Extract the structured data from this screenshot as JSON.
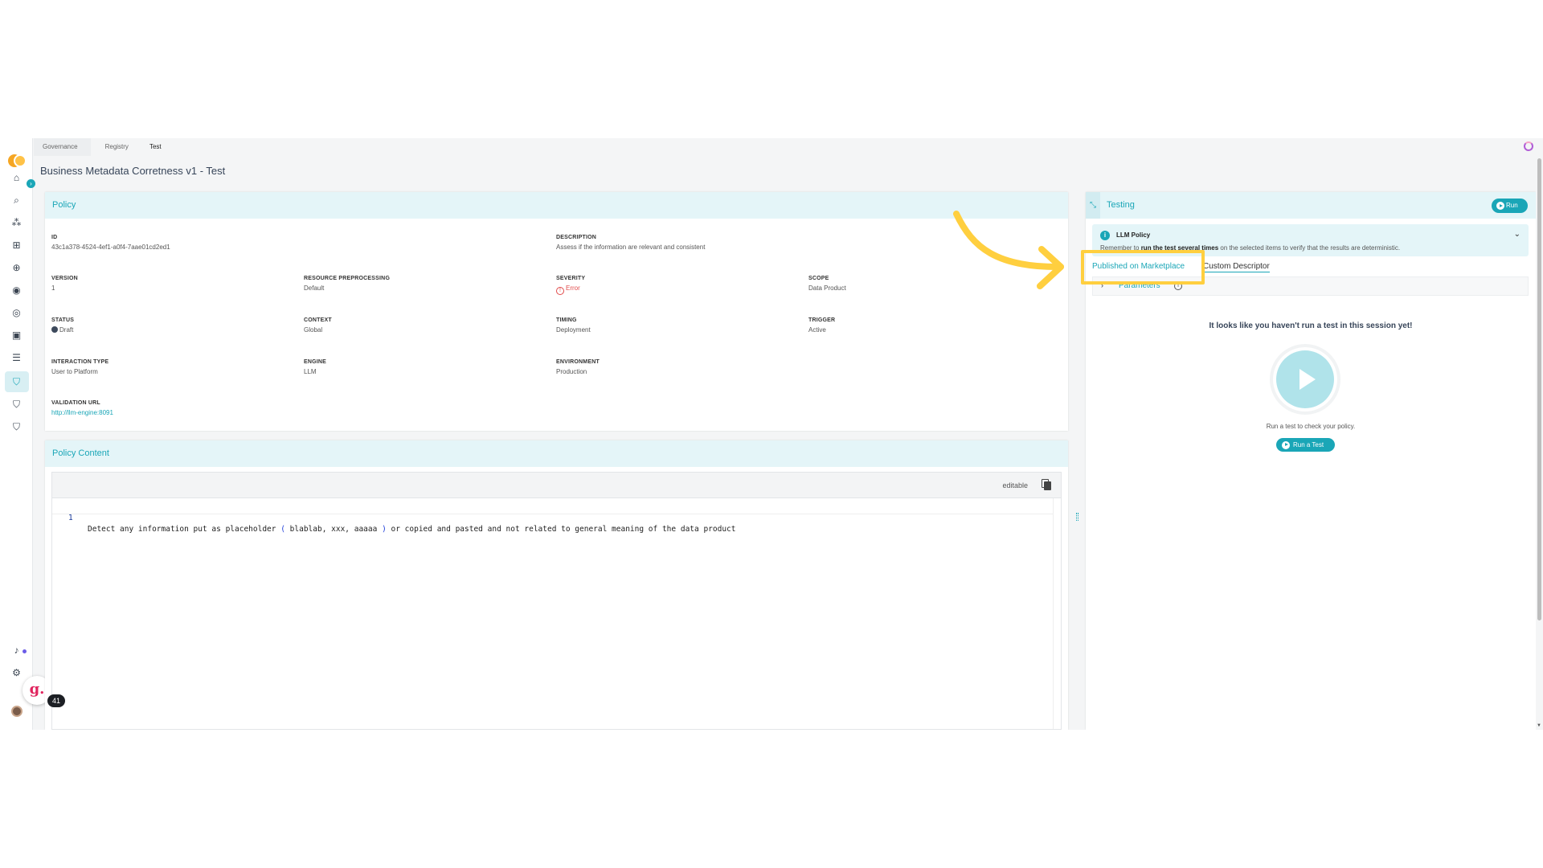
{
  "breadcrumb": [
    "Governance",
    "Registry",
    "Test"
  ],
  "page_title": "Business Metadata Corretness v1 - Test",
  "policy": {
    "header": "Policy",
    "fields": {
      "id": {
        "label": "ID",
        "value": "43c1a378-4524-4ef1-a0f4-7aae01cd2ed1"
      },
      "description": {
        "label": "DESCRIPTION",
        "value": "Assess if the information are relevant and consistent"
      },
      "version": {
        "label": "VERSION",
        "value": "1"
      },
      "resource_preprocessing": {
        "label": "RESOURCE PREPROCESSING",
        "value": "Default"
      },
      "severity": {
        "label": "SEVERITY",
        "value": "Error"
      },
      "scope": {
        "label": "SCOPE",
        "value": "Data Product"
      },
      "status": {
        "label": "STATUS",
        "value": "Draft"
      },
      "context": {
        "label": "CONTEXT",
        "value": "Global"
      },
      "timing": {
        "label": "TIMING",
        "value": "Deployment"
      },
      "trigger": {
        "label": "TRIGGER",
        "value": "Active"
      },
      "interaction_type": {
        "label": "INTERACTION TYPE",
        "value": "User to Platform"
      },
      "engine": {
        "label": "ENGINE",
        "value": "LLM"
      },
      "environment": {
        "label": "ENVIRONMENT",
        "value": "Production"
      },
      "validation_url": {
        "label": "VALIDATION URL",
        "value": "http://llm-engine:8091"
      }
    }
  },
  "policy_content": {
    "header": "Policy Content",
    "editable_label": "editable",
    "line_number": "1",
    "code_before": "Detect any information put as placeholder ",
    "code_paren_open": "(",
    "code_middle": " blablab, xxx, aaaaa ",
    "code_paren_close": ")",
    "code_after": " or copied and pasted and not related to general meaning of the data product"
  },
  "testing": {
    "header": "Testing",
    "run_label": "Run",
    "alert": {
      "title": "LLM Policy",
      "msg_prefix": "Remember to ",
      "msg_bold": "run the test several times",
      "msg_suffix": " on the selected items to verify that the results are deterministic."
    },
    "tabs": [
      "Published on Marketplace",
      "Custom Descriptor"
    ],
    "parameters_label": "Parameters",
    "empty_title": "It looks like you haven't run a test in this session yet!",
    "empty_msg": "Run a test to check your policy.",
    "run_test_label": "Run a Test"
  },
  "guide_badge_count": "41",
  "colors": {
    "accent": "#1aa6b7",
    "highlight": "#ffcf3f",
    "error": "#e14b4b"
  }
}
